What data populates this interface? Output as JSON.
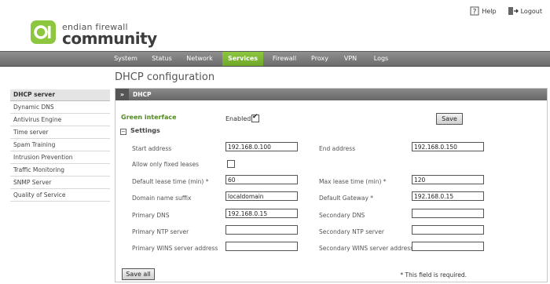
{
  "brand": {
    "line1": "endian firewall",
    "line2": "community",
    "accent": "#8dc63f"
  },
  "top_links": {
    "help": "Help",
    "logout": "Logout"
  },
  "nav": {
    "items": [
      "System",
      "Status",
      "Network",
      "Services",
      "Firewall",
      "Proxy",
      "VPN",
      "Logs"
    ],
    "active": "Services"
  },
  "page_title": "DHCP configuration",
  "sidebar": {
    "items": [
      "DHCP server",
      "Dynamic DNS",
      "Antivirus Engine",
      "Time server",
      "Spam Training",
      "Intrusion Prevention",
      "Traffic Monitoring",
      "SNMP Server",
      "Quality of Service"
    ],
    "active": "DHCP server"
  },
  "panel": {
    "arrows": "»",
    "title": "DHCP",
    "interface_label": "Green interface",
    "enabled_label": "Enabled",
    "enabled_checked": true,
    "save_label": "Save",
    "settings_toggle": "−",
    "settings_label": "Settings",
    "fields": {
      "start_address": {
        "label": "Start address",
        "value": "192.168.0.100"
      },
      "end_address": {
        "label": "End address",
        "value": "192.168.0.150"
      },
      "allow_fixed": {
        "label": "Allow only fixed leases",
        "checked": false
      },
      "default_lease": {
        "label": "Default lease time (min) *",
        "value": "60"
      },
      "max_lease": {
        "label": "Max lease time (min) *",
        "value": "120"
      },
      "domain_suffix": {
        "label": "Domain name suffix",
        "value": "localdomain"
      },
      "default_gateway": {
        "label": "Default Gateway *",
        "value": "192.168.0.15"
      },
      "primary_dns": {
        "label": "Primary DNS",
        "value": "192.168.0.15"
      },
      "secondary_dns": {
        "label": "Secondary DNS",
        "value": ""
      },
      "primary_ntp": {
        "label": "Primary NTP server",
        "value": ""
      },
      "secondary_ntp": {
        "label": "Secondary NTP server",
        "value": ""
      },
      "primary_wins": {
        "label": "Primary WINS server address",
        "value": ""
      },
      "secondary_wins": {
        "label": "Secondary WINS server address",
        "value": ""
      }
    },
    "save_all_label": "Save all",
    "required_note": "* This field is required."
  }
}
